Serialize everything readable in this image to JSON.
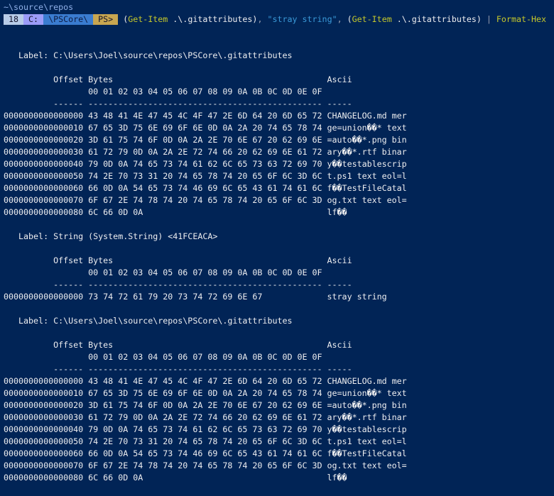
{
  "prompt": {
    "cwd": "~\\source\\repos",
    "history_number": "18",
    "drive": "C:",
    "folder": "\\PSCore\\",
    "ps": "PS>"
  },
  "command": {
    "open1": "(",
    "cmd1": "Get-Item",
    "arg1": " .\\.gitattributes)",
    "comma1": ", ",
    "string": "\"stray string\"",
    "comma2": ", ",
    "open2": "(",
    "cmd2": "Get-Item",
    "arg2": " .\\.gitattributes) ",
    "pipe": "|",
    "cmd3": " Format-Hex"
  },
  "header": {
    "offset": "Offset",
    "bytes": "Bytes",
    "ascii": "Ascii",
    "columns": "00 01 02 03 04 05 06 07 08 09 0A 0B 0C 0D 0E 0F"
  },
  "blocks": [
    {
      "label": "Label: C:\\Users\\Joel\\source\\repos\\PSCore\\.gitattributes",
      "rows": [
        {
          "offset": "0000000000000000",
          "hex": "43 48 41 4E 47 45 4C 4F 47 2E 6D 64 20 6D 65 72",
          "ascii": "CHANGELOG.md mer"
        },
        {
          "offset": "0000000000000010",
          "hex": "67 65 3D 75 6E 69 6F 6E 0D 0A 2A 20 74 65 78 74",
          "ascii": "ge=union��* text"
        },
        {
          "offset": "0000000000000020",
          "hex": "3D 61 75 74 6F 0D 0A 2A 2E 70 6E 67 20 62 69 6E",
          "ascii": "=auto��*.png bin"
        },
        {
          "offset": "0000000000000030",
          "hex": "61 72 79 0D 0A 2A 2E 72 74 66 20 62 69 6E 61 72",
          "ascii": "ary��*.rtf binar"
        },
        {
          "offset": "0000000000000040",
          "hex": "79 0D 0A 74 65 73 74 61 62 6C 65 73 63 72 69 70",
          "ascii": "y��testablescrip"
        },
        {
          "offset": "0000000000000050",
          "hex": "74 2E 70 73 31 20 74 65 78 74 20 65 6F 6C 3D 6C",
          "ascii": "t.ps1 text eol=l"
        },
        {
          "offset": "0000000000000060",
          "hex": "66 0D 0A 54 65 73 74 46 69 6C 65 43 61 74 61 6C",
          "ascii": "f��TestFileCatal"
        },
        {
          "offset": "0000000000000070",
          "hex": "6F 67 2E 74 78 74 20 74 65 78 74 20 65 6F 6C 3D",
          "ascii": "og.txt text eol="
        },
        {
          "offset": "0000000000000080",
          "hex": "6C 66 0D 0A",
          "ascii": "lf��"
        }
      ]
    },
    {
      "label": "Label: String (System.String) <41FCEACA>",
      "rows": [
        {
          "offset": "0000000000000000",
          "hex": "73 74 72 61 79 20 73 74 72 69 6E 67",
          "ascii": "stray string"
        }
      ]
    },
    {
      "label": "Label: C:\\Users\\Joel\\source\\repos\\PSCore\\.gitattributes",
      "rows": [
        {
          "offset": "0000000000000000",
          "hex": "43 48 41 4E 47 45 4C 4F 47 2E 6D 64 20 6D 65 72",
          "ascii": "CHANGELOG.md mer"
        },
        {
          "offset": "0000000000000010",
          "hex": "67 65 3D 75 6E 69 6F 6E 0D 0A 2A 20 74 65 78 74",
          "ascii": "ge=union��* text"
        },
        {
          "offset": "0000000000000020",
          "hex": "3D 61 75 74 6F 0D 0A 2A 2E 70 6E 67 20 62 69 6E",
          "ascii": "=auto��*.png bin"
        },
        {
          "offset": "0000000000000030",
          "hex": "61 72 79 0D 0A 2A 2E 72 74 66 20 62 69 6E 61 72",
          "ascii": "ary��*.rtf binar"
        },
        {
          "offset": "0000000000000040",
          "hex": "79 0D 0A 74 65 73 74 61 62 6C 65 73 63 72 69 70",
          "ascii": "y��testablescrip"
        },
        {
          "offset": "0000000000000050",
          "hex": "74 2E 70 73 31 20 74 65 78 74 20 65 6F 6C 3D 6C",
          "ascii": "t.ps1 text eol=l"
        },
        {
          "offset": "0000000000000060",
          "hex": "66 0D 0A 54 65 73 74 46 69 6C 65 43 61 74 61 6C",
          "ascii": "f��TestFileCatal"
        },
        {
          "offset": "0000000000000070",
          "hex": "6F 67 2E 74 78 74 20 74 65 78 74 20 65 6F 6C 3D",
          "ascii": "og.txt text eol="
        },
        {
          "offset": "0000000000000080",
          "hex": "6C 66 0D 0A",
          "ascii": "lf��"
        }
      ]
    }
  ]
}
